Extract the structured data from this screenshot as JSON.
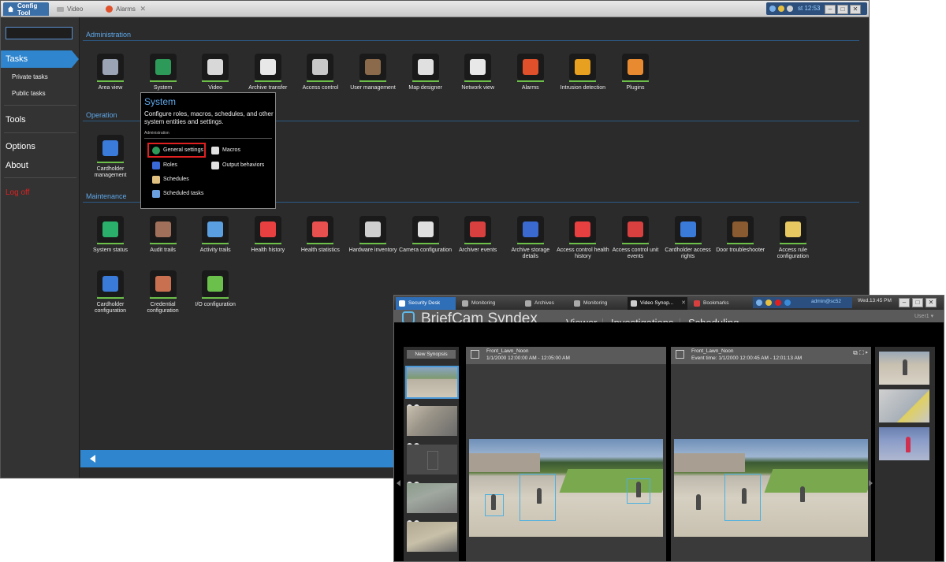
{
  "config_tool": {
    "tabs": [
      {
        "label": "Config Tool"
      },
      {
        "label": "Video"
      },
      {
        "label": "Alarms"
      }
    ],
    "tray_time": "st 12:53",
    "sidebar": {
      "tasks": "Tasks",
      "private_tasks": "Private tasks",
      "public_tasks": "Public tasks",
      "tools": "Tools",
      "options": "Options",
      "about": "About",
      "logoff": "Log off"
    },
    "sections": {
      "administration": "Administration",
      "operation": "Operation",
      "maintenance": "Maintenance"
    },
    "admin_tiles": [
      {
        "label": "Area view",
        "icon": "area-view-icon",
        "color": "#9aa4b4"
      },
      {
        "label": "System",
        "icon": "globe-icon",
        "color": "#2e9a5a"
      },
      {
        "label": "Video",
        "icon": "camera-icon",
        "color": "#d8d8d8"
      },
      {
        "label": "Archive transfer",
        "icon": "archive-transfer-icon",
        "color": "#e8e8e8"
      },
      {
        "label": "Access control",
        "icon": "access-control-icon",
        "color": "#c8c8c8"
      },
      {
        "label": "User management",
        "icon": "user-icon",
        "color": "#8a6a4a"
      },
      {
        "label": "Map designer",
        "icon": "map-icon",
        "color": "#e0e0e0"
      },
      {
        "label": "Network view",
        "icon": "network-icon",
        "color": "#e8e8e8"
      },
      {
        "label": "Alarms",
        "icon": "alarm-icon",
        "color": "#e0502a"
      },
      {
        "label": "Intrusion detection",
        "icon": "shield-icon",
        "color": "#e8a020"
      },
      {
        "label": "Plugins",
        "icon": "plugin-icon",
        "color": "#e88a30"
      }
    ],
    "operation_tiles": [
      {
        "label": "Cardholder management",
        "icon": "cardholder-icon",
        "color": "#3a7ad8"
      }
    ],
    "maintenance_tiles": [
      {
        "label": "System status",
        "icon": "system-status-icon",
        "color": "#2ab06a"
      },
      {
        "label": "Audit trails",
        "icon": "audit-trails-icon",
        "color": "#a0705a"
      },
      {
        "label": "Activity trails",
        "icon": "activity-trails-icon",
        "color": "#5aa0e0"
      },
      {
        "label": "Health history",
        "icon": "health-history-icon",
        "color": "#e84040"
      },
      {
        "label": "Health statistics",
        "icon": "health-statistics-icon",
        "color": "#e85050"
      },
      {
        "label": "Hardware inventory",
        "icon": "hardware-inventory-icon",
        "color": "#d0d0d0"
      },
      {
        "label": "Camera configuration",
        "icon": "camera-configuration-icon",
        "color": "#e0e0e0"
      },
      {
        "label": "Archiver events",
        "icon": "archiver-events-icon",
        "color": "#d84040"
      },
      {
        "label": "Archive storage details",
        "icon": "archive-storage-icon",
        "color": "#3a6ad0"
      },
      {
        "label": "Access control health history",
        "icon": "access-health-icon",
        "color": "#e84040"
      },
      {
        "label": "Access control unit events",
        "icon": "access-unit-events-icon",
        "color": "#d84040"
      },
      {
        "label": "Cardholder access rights",
        "icon": "cardholder-access-icon",
        "color": "#3a7ad8"
      },
      {
        "label": "Door troubleshooter",
        "icon": "door-icon",
        "color": "#8a5a30"
      },
      {
        "label": "Access rule configuration",
        "icon": "access-rule-icon",
        "color": "#e8c860"
      }
    ],
    "config_tiles": [
      {
        "label": "Cardholder configuration",
        "icon": "cardholder-configuration-icon",
        "color": "#3a7ad8"
      },
      {
        "label": "Credential configuration",
        "icon": "credential-icon",
        "color": "#c87050"
      },
      {
        "label": "I/O configuration",
        "icon": "io-configuration-icon",
        "color": "#6ac04a"
      }
    ],
    "popup": {
      "title": "System",
      "description": "Configure roles, macros, schedules, and other system entities and settings.",
      "section": "Administration",
      "items": [
        {
          "label": "General settings",
          "icon": "globe-icon",
          "color": "#2e9a5a"
        },
        {
          "label": "Macros",
          "icon": "macro-icon",
          "color": "#e0e0e0"
        },
        {
          "label": "Roles",
          "icon": "roles-icon",
          "color": "#3a6ad8"
        },
        {
          "label": "Output behaviors",
          "icon": "output-behavior-icon",
          "color": "#e0e0e0"
        },
        {
          "label": "Schedules",
          "icon": "schedule-icon",
          "color": "#e0c080"
        },
        {
          "label": "Scheduled tasks",
          "icon": "scheduled-task-icon",
          "color": "#6aa0e0"
        }
      ]
    }
  },
  "security_desk": {
    "tabs": [
      {
        "label": "Security Desk"
      },
      {
        "label": "Monitoring"
      },
      {
        "label": "Archives"
      },
      {
        "label": "Monitoring"
      },
      {
        "label": "Video Synop..."
      },
      {
        "label": "Bookmarks"
      }
    ],
    "user_tray": "admin@sc52",
    "time": "Wed.13:45 PM",
    "logo_text": "BriefCam Syndex",
    "nav": {
      "viewer": "Viewer",
      "investigations": "Investigations",
      "scheduling": "Scheduling"
    },
    "user": "User1",
    "new_synopsis": "New Synopsis",
    "pane_left": {
      "title": "Front_Lawn_Noon",
      "subtitle": "1/1/2000 12:00:00 AM - 12:05:00 AM"
    },
    "pane_right": {
      "title": "Front_Lawn_Noon",
      "subtitle": "Event time: 1/1/2000 12:00:45 AM - 12:01:13 AM"
    }
  }
}
